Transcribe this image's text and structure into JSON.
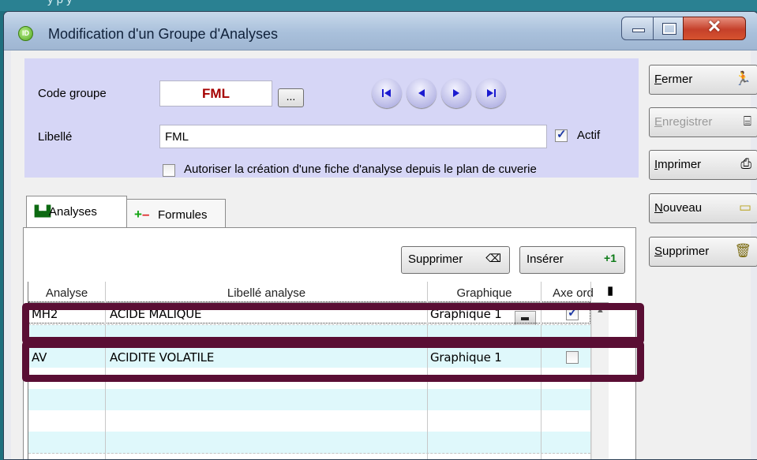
{
  "window": {
    "title": "Modification d'un Groupe d'Analyses",
    "top_partial_text": "y     p    y"
  },
  "header": {
    "code_label": "Code groupe",
    "code_value": "FML",
    "dots_label": "...",
    "libelle_label": "Libellé",
    "libelle_value": "FML",
    "actif_label": "Actif",
    "actif_checked": true,
    "autoriser_label": "Autoriser la création d'une fiche d'analyse depuis le plan de cuverie",
    "autoriser_checked": false
  },
  "tabs": [
    {
      "label": "Analyses",
      "icon": "chart-icon",
      "active": true
    },
    {
      "label": "Formules",
      "icon": "plus-minus-icon",
      "active": false
    }
  ],
  "toolbar": {
    "supprimer_label": "Supprimer",
    "inserer_label": "Insérer",
    "inserer_icon_text": "+1"
  },
  "grid": {
    "headers": [
      "Analyse",
      "Libellé analyse",
      "Graphique",
      "Axe ord"
    ],
    "rows": [
      {
        "analyse": "MH2",
        "libelle": "ACIDE MALIQUE",
        "graphique": "Graphique 1",
        "axe_ord": true
      },
      {
        "analyse": "AV",
        "libelle": "ACIDITE VOLATILE",
        "graphique": "Graphique 1",
        "axe_ord": false
      }
    ]
  },
  "side_buttons": [
    {
      "label": "Fermer",
      "underline": "F",
      "rest": "ermer",
      "enabled": true,
      "icon": "exit-icon"
    },
    {
      "label": "Enregistrer",
      "underline": "E",
      "rest": "nregistrer",
      "enabled": false,
      "icon": "save-icon"
    },
    {
      "label": "Imprimer",
      "underline": "I",
      "rest": "mprimer",
      "enabled": true,
      "icon": "printer-icon"
    },
    {
      "label": "Nouveau",
      "underline": "N",
      "rest": "ouveau",
      "enabled": true,
      "icon": "new-icon"
    },
    {
      "label": "Supprimer",
      "underline": "S",
      "rest": "upprimer",
      "enabled": true,
      "icon": "delete-icon"
    }
  ],
  "colors": {
    "header_panel": "#d6d6f6",
    "highlight_box": "#5a0e34",
    "code_text": "#a50000",
    "row_alt": "#dff8fb"
  }
}
